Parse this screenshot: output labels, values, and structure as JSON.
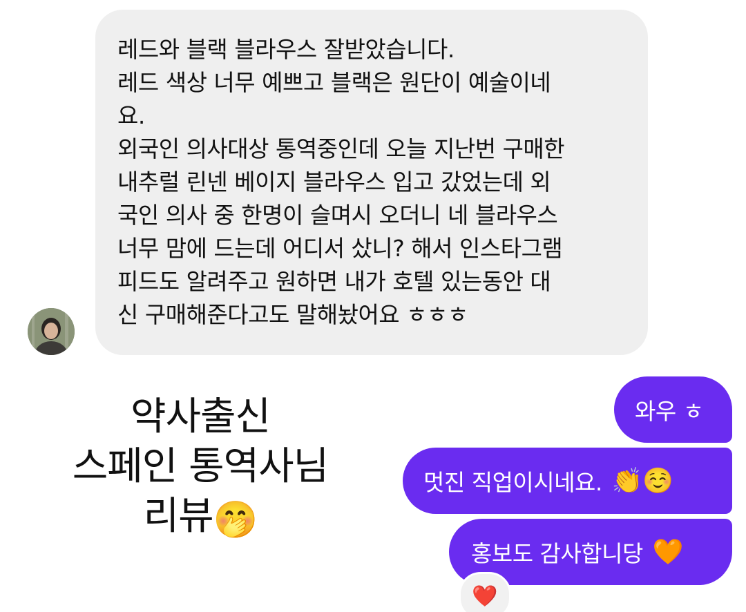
{
  "incoming": {
    "lines": [
      "레드와 블랙 블라우스 잘받았습니다.",
      "레드 색상 너무 예쁘고 블랙은 원단이 예술이네",
      "요.",
      "외국인 의사대상 통역중인데 오늘 지난번 구매한",
      "내추럴 린넨 베이지 블라우스 입고 갔었는데 외",
      "국인 의사 중 한명이 슬며시 오더니 네 블라우스",
      "너무 맘에 드는데 어디서 샀니? 해서 인스타그램",
      "피드도 알려주고 원하면 내가 호텔 있는동안 대",
      "신 구매해준다고도 말해놨어요 ㅎㅎㅎ"
    ]
  },
  "caption": {
    "line1": "약사출신",
    "line2": "스페인 통역사님",
    "line3": "리뷰",
    "emoji": "🤭"
  },
  "outgoing": {
    "msg1": "와우 ㅎ",
    "msg2": "멋진 직업이시네요.",
    "msg2_emoji": "👏☺️",
    "msg3": "홍보도 감사합니당",
    "msg3_emoji": "🧡"
  },
  "reaction": {
    "emoji": "❤️"
  },
  "colors": {
    "outgoing_bubble": "#6a2cf0",
    "incoming_bubble": "#efefef"
  }
}
